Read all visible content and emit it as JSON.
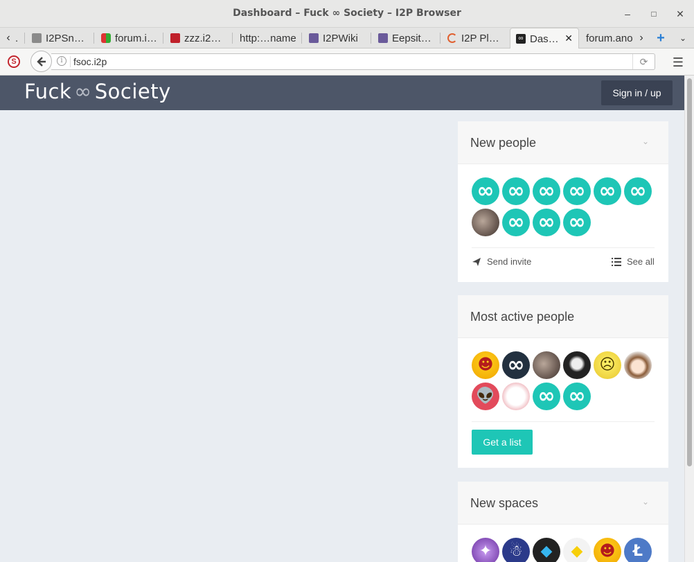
{
  "window": {
    "title": "Dashboard – Fuck ∞ Society – I2P Browser",
    "minimize_glyph": "–",
    "maximize_glyph": "□",
    "close_glyph": "✕"
  },
  "tabs": [
    {
      "label": "I2PSn…",
      "icon": "squirrel-icon",
      "color": "#777"
    },
    {
      "label": "forum.i…",
      "icon": "forum-icon",
      "color": "#3a3"
    },
    {
      "label": "zzz.i2…",
      "icon": "zzz-icon",
      "color": "#c0202a"
    },
    {
      "label": "http:…name",
      "icon": "",
      "color": ""
    },
    {
      "label": "I2PWiki",
      "icon": "wiki-icon",
      "color": "#6a5a9a"
    },
    {
      "label": "Eepsit…",
      "icon": "wiki-icon",
      "color": "#6a5a9a"
    },
    {
      "label": "I2P Pl…",
      "icon": "loading-icon",
      "color": "#e06030"
    },
    {
      "label": "Das…",
      "icon": "infinity-icon",
      "color": "#222",
      "active": true
    },
    {
      "label": "forum.ano",
      "icon": "",
      "color": ""
    }
  ],
  "tab_controls": {
    "scroll_left": "‹",
    "scroll_right": "›",
    "new_tab": "+",
    "list_all": "⌄",
    "close_tab": "✕"
  },
  "navbar": {
    "url": "fsoc.i2p",
    "back_glyph": "🡐",
    "reload_glyph": "⟳",
    "menu_glyph": "☰",
    "plugin_glyph": "S"
  },
  "site": {
    "logo_left": "Fuck",
    "logo_symbol": "∞",
    "logo_right": "Society",
    "signin_label": "Sign in / up"
  },
  "new_people": {
    "title": "New people",
    "chevron": "⌄",
    "avatars": [
      "infinity",
      "infinity",
      "infinity",
      "infinity",
      "infinity",
      "infinity",
      "cat-photo",
      "infinity",
      "infinity",
      "infinity"
    ],
    "send_invite_label": "Send invite",
    "see_all_label": "See all"
  },
  "most_active": {
    "title": "Most active people",
    "avatars": [
      "awesome-face",
      "infinity-dark",
      "cat-photo",
      "anime-dark",
      "yellow-meme",
      "anime-girl",
      "alien",
      "white-cat",
      "infinity",
      "infinity"
    ],
    "button_label": "Get a list"
  },
  "new_spaces": {
    "title": "New spaces",
    "chevron": "⌄",
    "avatars": [
      "purple-emblem",
      "blue-mascot",
      "diamond",
      "warning-sign",
      "awesome-face",
      "litecoin"
    ]
  },
  "colors": {
    "accent": "#1ec6b6",
    "header": "#4d5668",
    "signin": "#3a4253"
  }
}
